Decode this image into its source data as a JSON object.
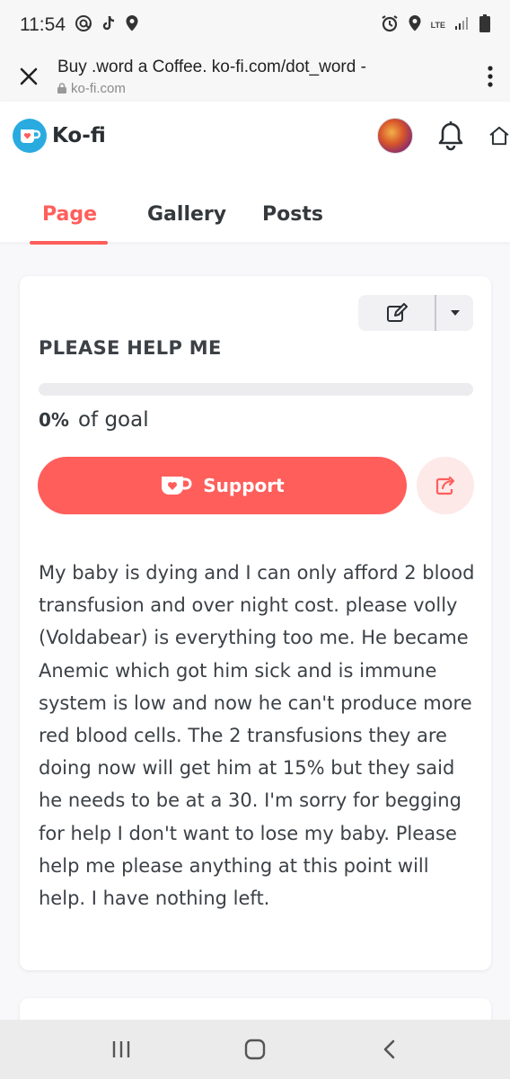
{
  "status_bar": {
    "time": "11:54",
    "network": "LTE"
  },
  "browser": {
    "page_title": "Buy .word a Coffee. ko-fi.com/dot_word -",
    "domain": "ko-fi.com"
  },
  "header": {
    "logo_text": "Ko-fi"
  },
  "tabs": [
    {
      "label": "Page",
      "active": true
    },
    {
      "label": "Gallery",
      "active": false
    },
    {
      "label": "Posts",
      "active": false
    }
  ],
  "goal": {
    "title": "PLEASE HELP ME",
    "progress_percent": 0,
    "percent_text": "0%",
    "suffix": "of goal"
  },
  "support_button": {
    "label": "Support"
  },
  "description": "My baby is dying and I can only afford 2 blood transfusion and over night cost. please volly (Voldabear) is everything too me. He became Anemic which got him sick and is immune system is low and now he can't produce more red blood cells. The 2 transfusions they are doing now will get him at 15% but they said he needs to be at a 30. I'm sorry for begging for help I don't want to lose my baby. Please help me please anything at this point will help. I have nothing left.",
  "colors": {
    "accent": "#ff5e5b",
    "accent_light": "#fde9e8",
    "text": "#33393c",
    "logo_blue": "#29abe0"
  },
  "icons": {
    "status_left": [
      "at-icon",
      "tiktok-icon",
      "location-icon"
    ],
    "status_right": [
      "alarm-icon",
      "location-icon",
      "signal-icon",
      "battery-icon"
    ],
    "nav": [
      "recent-apps-icon",
      "home-button-icon",
      "back-icon"
    ]
  }
}
